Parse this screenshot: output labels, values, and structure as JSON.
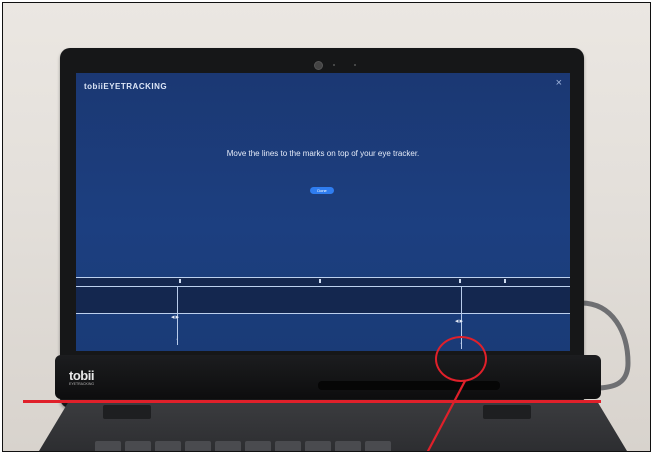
{
  "screen": {
    "brand_text": "tobiiEYETRACKING",
    "close_symbol": "×",
    "instruction": "Move the lines to the marks on top of your eye tracker.",
    "done_label": "Done",
    "arrow_glyph": "◂▸"
  },
  "device": {
    "logo": "tobii",
    "logo_sub": "EYETRACKING"
  },
  "colors": {
    "annotation": "#e0202a",
    "screen_bg": "#1c3f80",
    "button": "#2f7df0"
  }
}
